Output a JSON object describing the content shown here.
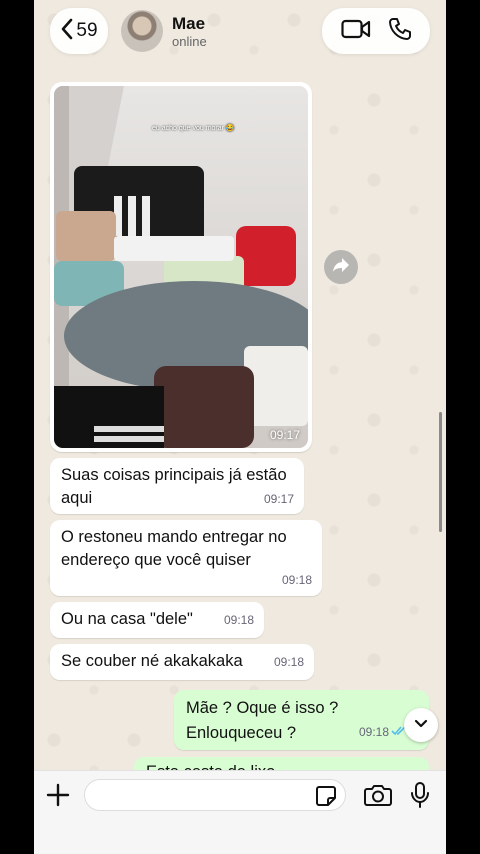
{
  "header": {
    "back_count": "59",
    "contact_name": "Mae",
    "contact_status": "online"
  },
  "media": {
    "caption": "eu acho que vou morar 😂",
    "time": "09:17"
  },
  "messages_in": [
    {
      "line1": "Suas coisas principais já estão",
      "line2": "aqui",
      "time": "09:17"
    },
    {
      "line1": "O restoneu mando entregar no",
      "line2": "endereço que você quiser",
      "time": "09:18"
    },
    {
      "text": "Ou na casa \"dele\"",
      "time": "09:18"
    },
    {
      "text": "Se couber né akakakaka",
      "time": "09:18"
    }
  ],
  "message_out": {
    "line1": "Mãe ? Oque é isso ?",
    "line2": "Enlouqueceu ?",
    "time": "09:18"
  },
  "message_out_partial": "Esta cesta de lixo...",
  "input": {
    "placeholder": ""
  },
  "colors": {
    "outgoing_bubble": "#d9fdd3",
    "incoming_bubble": "#ffffff",
    "read_tick": "#53bdeb"
  }
}
